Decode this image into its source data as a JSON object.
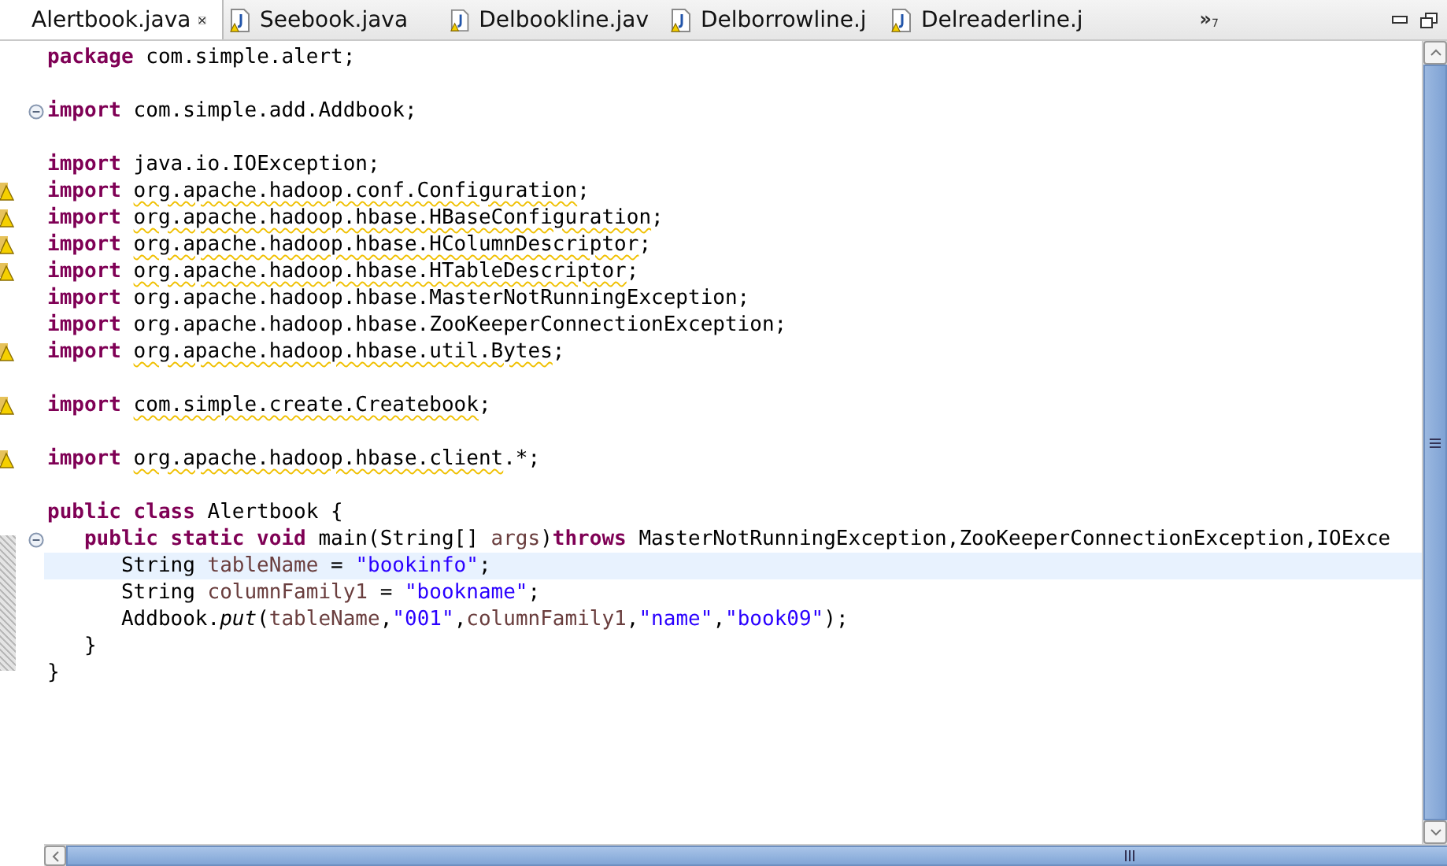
{
  "tabs": [
    {
      "label": "Alertbook.java",
      "selected": true
    },
    {
      "label": "Seebook.java",
      "selected": false
    },
    {
      "label": "Delbookline.jav",
      "selected": false
    },
    {
      "label": "Delborrowline.j",
      "selected": false
    },
    {
      "label": "Delreaderline.j",
      "selected": false
    }
  ],
  "overflow": {
    "symbol": "»",
    "count": "7"
  },
  "editor": {
    "lines": [
      {
        "kind": "plain",
        "current": false,
        "tokens": [
          {
            "kind": "keyword",
            "text": "package "
          },
          {
            "kind": "plain",
            "text": "com.simple.alert;"
          }
        ]
      },
      {
        "kind": "plain",
        "current": false
      },
      {
        "kind": "fold",
        "current": false,
        "tokens": [
          {
            "kind": "keyword",
            "text": "import "
          },
          {
            "kind": "plain",
            "text": "com.simple.add.Addbook;"
          }
        ]
      },
      {
        "kind": "plain",
        "current": false
      },
      {
        "kind": "plain",
        "current": false,
        "tokens": [
          {
            "kind": "keyword",
            "text": "import "
          },
          {
            "kind": "plain",
            "text": "java.io.IOException;"
          }
        ]
      },
      {
        "kind": "warning",
        "current": false,
        "tokens": [
          {
            "kind": "keyword",
            "text": "import "
          },
          {
            "kind": "warned",
            "text": "org.apache.hadoop.conf.Configuration"
          },
          {
            "kind": "plain",
            "text": ";"
          }
        ]
      },
      {
        "kind": "warning",
        "current": false,
        "tokens": [
          {
            "kind": "keyword",
            "text": "import "
          },
          {
            "kind": "warned",
            "text": "org.apache.hadoop.hbase.HBaseConfiguration"
          },
          {
            "kind": "plain",
            "text": ";"
          }
        ]
      },
      {
        "kind": "warning",
        "current": false,
        "tokens": [
          {
            "kind": "keyword",
            "text": "import "
          },
          {
            "kind": "warned",
            "text": "org.apache.hadoop.hbase.HColumnDescriptor"
          },
          {
            "kind": "plain",
            "text": ";"
          }
        ]
      },
      {
        "kind": "warning",
        "current": false,
        "tokens": [
          {
            "kind": "keyword",
            "text": "import "
          },
          {
            "kind": "warned",
            "text": "org.apache.hadoop.hbase.HTableDescriptor"
          },
          {
            "kind": "plain",
            "text": ";"
          }
        ]
      },
      {
        "kind": "plain",
        "current": false,
        "tokens": [
          {
            "kind": "keyword",
            "text": "import "
          },
          {
            "kind": "plain",
            "text": "org.apache.hadoop.hbase.MasterNotRunningException;"
          }
        ]
      },
      {
        "kind": "plain",
        "current": false,
        "tokens": [
          {
            "kind": "keyword",
            "text": "import "
          },
          {
            "kind": "plain",
            "text": "org.apache.hadoop.hbase.ZooKeeperConnectionException;"
          }
        ]
      },
      {
        "kind": "warning",
        "current": false,
        "tokens": [
          {
            "kind": "keyword",
            "text": "import "
          },
          {
            "kind": "warned",
            "text": "org.apache.hadoop.hbase.util.Bytes"
          },
          {
            "kind": "plain",
            "text": ";"
          }
        ]
      },
      {
        "kind": "plain",
        "current": false
      },
      {
        "kind": "warning",
        "current": false,
        "tokens": [
          {
            "kind": "keyword",
            "text": "import "
          },
          {
            "kind": "warned",
            "text": "com.simple.create.Createbook"
          },
          {
            "kind": "plain",
            "text": ";"
          }
        ]
      },
      {
        "kind": "plain",
        "current": false
      },
      {
        "kind": "warning",
        "current": false,
        "tokens": [
          {
            "kind": "keyword",
            "text": "import "
          },
          {
            "kind": "warned",
            "text": "org.apache.hadoop.hbase.client"
          },
          {
            "kind": "plain",
            "text": ".*;"
          }
        ]
      },
      {
        "kind": "plain",
        "current": false
      },
      {
        "kind": "plain",
        "current": false,
        "tokens": [
          {
            "kind": "keyword",
            "text": "public class "
          },
          {
            "kind": "plain",
            "text": "Alertbook {"
          }
        ]
      },
      {
        "kind": "fold",
        "current": false,
        "tokens": [
          {
            "kind": "keyword",
            "text": "   public static void "
          },
          {
            "kind": "plain",
            "text": "main(String[] "
          },
          {
            "kind": "variable",
            "text": "args"
          },
          {
            "kind": "plain",
            "text": ")"
          },
          {
            "kind": "keyword",
            "text": "throws "
          },
          {
            "kind": "plain",
            "text": "MasterNotRunningException,ZooKeeperConnectionException,IOExce"
          }
        ]
      },
      {
        "kind": "plain",
        "current": true,
        "tokens": [
          {
            "kind": "plain",
            "text": "      String "
          },
          {
            "kind": "variable",
            "text": "tableName"
          },
          {
            "kind": "plain",
            "text": " = "
          },
          {
            "kind": "string",
            "text": "\"bookinfo\""
          },
          {
            "kind": "plain",
            "text": ";"
          }
        ]
      },
      {
        "kind": "plain",
        "current": false,
        "tokens": [
          {
            "kind": "plain",
            "text": "      String "
          },
          {
            "kind": "variable",
            "text": "columnFamily1"
          },
          {
            "kind": "plain",
            "text": " = "
          },
          {
            "kind": "string",
            "text": "\"bookname\""
          },
          {
            "kind": "plain",
            "text": ";"
          }
        ]
      },
      {
        "kind": "plain",
        "current": false,
        "tokens": [
          {
            "kind": "plain",
            "text": "      Addbook."
          },
          {
            "kind": "method",
            "text": "put"
          },
          {
            "kind": "plain",
            "text": "("
          },
          {
            "kind": "variable",
            "text": "tableName"
          },
          {
            "kind": "plain",
            "text": ","
          },
          {
            "kind": "string",
            "text": "\"001\""
          },
          {
            "kind": "plain",
            "text": ","
          },
          {
            "kind": "variable",
            "text": "columnFamily1"
          },
          {
            "kind": "plain",
            "text": ","
          },
          {
            "kind": "string",
            "text": "\"name\""
          },
          {
            "kind": "plain",
            "text": ","
          },
          {
            "kind": "string",
            "text": "\"book09\""
          },
          {
            "kind": "plain",
            "text": ");"
          }
        ]
      },
      {
        "kind": "plain",
        "current": false,
        "tokens": [
          {
            "kind": "plain",
            "text": "   }"
          }
        ]
      },
      {
        "kind": "plain",
        "current": false,
        "tokens": [
          {
            "kind": "plain",
            "text": "}"
          }
        ]
      }
    ]
  }
}
